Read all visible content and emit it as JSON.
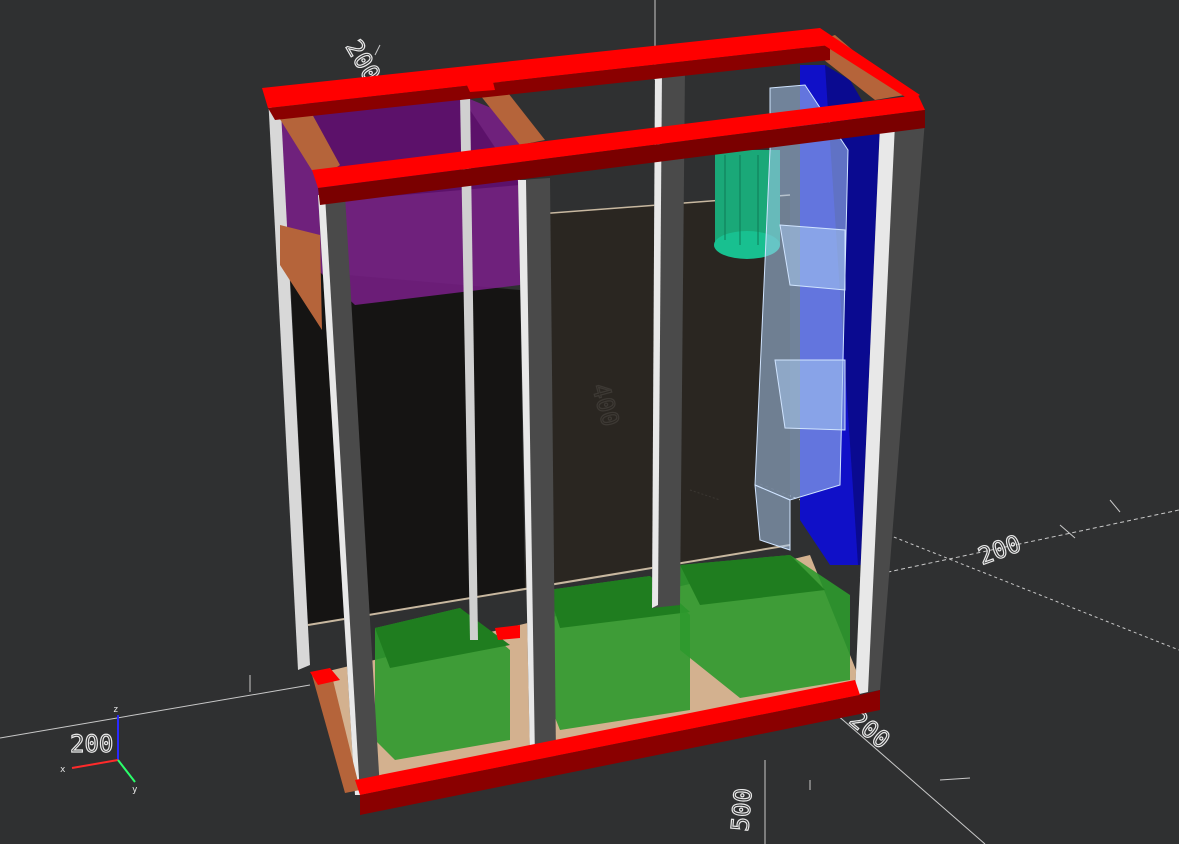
{
  "viewport": {
    "background": "#2f3031",
    "axis_gizmo": {
      "x_label": "x",
      "y_label": "y",
      "z_label": "z"
    },
    "ruler_marks": {
      "x_positive": "200",
      "x_negative": "200",
      "y_positive": "200",
      "y_negative": "200",
      "z_top": "400",
      "y_front": "500"
    }
  },
  "model": {
    "frame_color": "#ff0000",
    "post_color": "#4a4a4a",
    "post_edge_color": "#d8d8d8",
    "wood_color": "#b5643a",
    "purple_box_color": "#7a1f8a",
    "panel_color": "#1a1714",
    "green_box_color": "#2e9a2e",
    "cylinder_color": "#1aa878",
    "light_blue_color": "#a8c8f0",
    "blue_panel_color": "#1010c8",
    "floor_color": "#f0c8a0"
  }
}
